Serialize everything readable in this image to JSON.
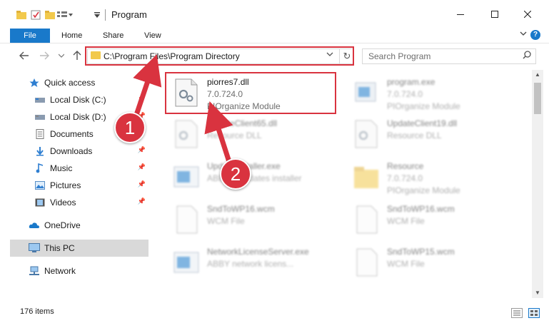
{
  "window": {
    "title": "Program"
  },
  "ribbon": {
    "tabs": [
      "File",
      "Home",
      "Share",
      "View"
    ]
  },
  "address": {
    "path": "C:\\Program Files\\Program Directory"
  },
  "search": {
    "placeholder": "Search Program"
  },
  "nav": {
    "quick_access": "Quick access",
    "local_c": "Local Disk (C:)",
    "local_d": "Local Disk (D:)",
    "documents": "Documents",
    "downloads": "Downloads",
    "music": "Music",
    "pictures": "Pictures",
    "videos": "Videos",
    "onedrive": "OneDrive",
    "this_pc": "This PC",
    "network": "Network"
  },
  "files": [
    {
      "name": "piorres7.dll",
      "line2": "7.0.724.0",
      "line3": "PIOrganize Module"
    },
    {
      "name": "program.exe",
      "line2": "7.0.724.0",
      "line3": "PIOrganize Module"
    },
    {
      "name": "UpdateClient65.dll",
      "line2": "Resource DLL",
      "line3": ""
    },
    {
      "name": "UpdateClient19.dll",
      "line2": "Resource DLL",
      "line3": ""
    },
    {
      "name": "UpdateInstaller.exe",
      "line2": "ABBYY Updates installer",
      "line3": ""
    },
    {
      "name": "Resource",
      "line2": "7.0.724.0",
      "line3": "PIOrganize Module"
    },
    {
      "name": "SndToWP16.wcm",
      "line2": "WCM File",
      "line3": ""
    },
    {
      "name": "SndToWP16.wcm",
      "line2": "WCM File",
      "line3": ""
    },
    {
      "name": "NetworkLicenseServer.exe",
      "line2": "ABBY network licens...",
      "line3": ""
    },
    {
      "name": "SndToWP15.wcm",
      "line2": "WCM File",
      "line3": ""
    }
  ],
  "status": {
    "items": "176 items"
  },
  "annotations": {
    "step1": "1",
    "step2": "2"
  },
  "colors": {
    "accent": "#1979ca",
    "highlight": "#d9333f",
    "folder": "#f2c94c"
  }
}
